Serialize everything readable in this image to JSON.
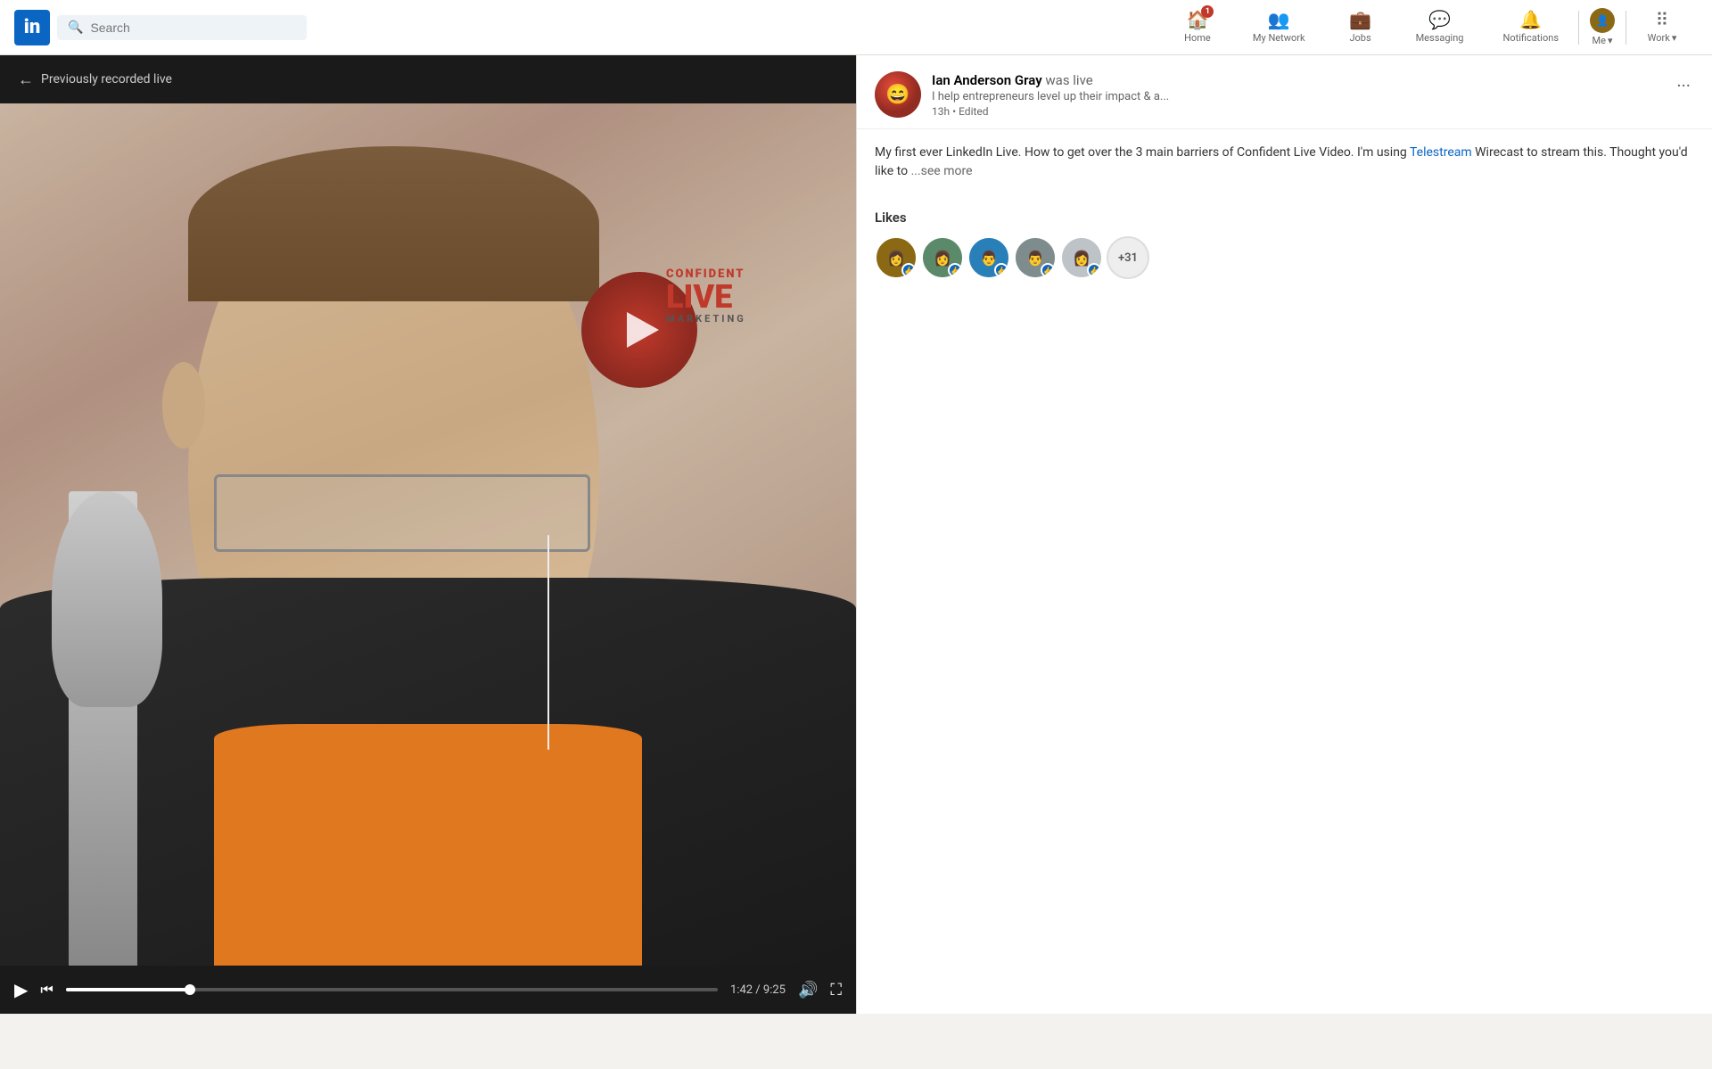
{
  "nav": {
    "logo_text": "in",
    "search_placeholder": "Search",
    "items": [
      {
        "id": "home",
        "label": "Home",
        "icon": "🏠",
        "badge": "1"
      },
      {
        "id": "my-network",
        "label": "My Network",
        "icon": "👥",
        "badge": null
      },
      {
        "id": "jobs",
        "label": "Jobs",
        "icon": "💼",
        "badge": null
      },
      {
        "id": "messaging",
        "label": "Messaging",
        "icon": "💬",
        "badge": null
      },
      {
        "id": "notifications",
        "label": "Notifications",
        "icon": "🔔",
        "badge": null
      }
    ],
    "me_label": "Me",
    "work_label": "Work"
  },
  "video": {
    "back_label": "Previously recorded live",
    "time_current": "1:42",
    "time_total": "9:25",
    "time_display": "1:42 / 9:25",
    "logo_confident": "CONFIDENT",
    "logo_live": "LIVE",
    "logo_marketing": "MARKETING"
  },
  "post": {
    "author_name": "Ian Anderson Gray",
    "was_live_text": " was live",
    "subtitle": "I help entrepreneurs level up their impact & a...",
    "time": "13h • Edited",
    "body_text": "My first ever LinkedIn Live. How to get over the 3 main barriers of Confident Live Video. I'm using ",
    "link_text": "Telestream",
    "body_text2": " Wirecast to stream this. Thought you'd like to",
    "see_more": "...see more",
    "likes_title": "Likes",
    "more_likes_count": "+31",
    "avatars": [
      {
        "bg": "#8b6914",
        "emoji": "👩"
      },
      {
        "bg": "#5b8a6a",
        "emoji": "👩"
      },
      {
        "bg": "#2980b9",
        "emoji": "👨"
      },
      {
        "bg": "#7f8c8d",
        "emoji": "👨"
      },
      {
        "bg": "#bdc3c7",
        "emoji": "👩"
      }
    ]
  }
}
